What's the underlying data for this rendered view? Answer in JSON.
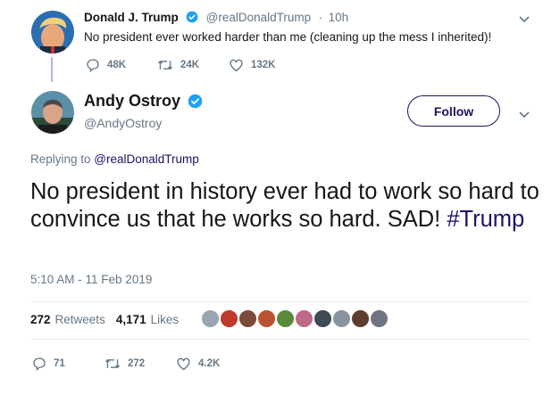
{
  "parent_tweet": {
    "name": "Donald J. Trump",
    "handle": "@realDonaldTrump",
    "separator": "·",
    "time": "10h",
    "text": "No president ever worked harder than me (cleaning up the mess I inherited)!",
    "actions": {
      "replies": "48K",
      "retweets": "24K",
      "likes": "132K"
    }
  },
  "main_tweet": {
    "name": "Andy Ostroy",
    "handle": "@AndyOstroy",
    "follow_label": "Follow",
    "replying_prefix": "Replying to ",
    "replying_to": "@realDonaldTrump",
    "text_main": "No president in history ever had to work so hard to convince us that he works so hard. SAD! ",
    "hashtag": "#Trump",
    "timestamp": "5:10 AM - 11 Feb 2019",
    "retweets_count": "272",
    "retweets_label": "Retweets",
    "likes_count": "4,171",
    "likes_label": "Likes",
    "actions": {
      "replies": "71",
      "retweets": "272",
      "likes": "4.2K"
    }
  },
  "colors": {
    "brand": "#1b1464",
    "verified": "#1da1f2",
    "muted": "#657786",
    "thread_line": "#c2b0d8"
  },
  "liker_avatars": [
    "#9aa5b1",
    "#c0392b",
    "#7b4a3a",
    "#b9532f",
    "#5a8a3a",
    "#c06a8a",
    "#3f4a55",
    "#8a94a0",
    "#5c3d2e",
    "#6d7680"
  ]
}
